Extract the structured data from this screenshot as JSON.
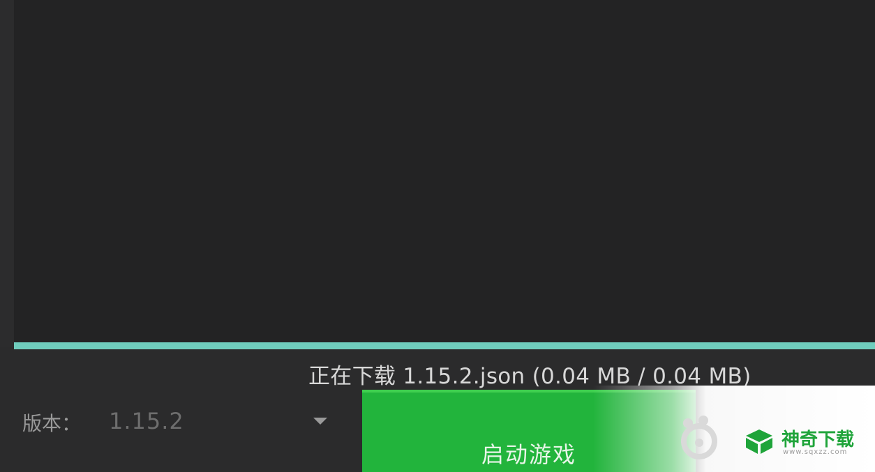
{
  "download": {
    "status_text": "正在下载 1.15.2.json (0.04 MB / 0.04 MB)",
    "progress_fraction": 1.0
  },
  "version": {
    "label": "版本：",
    "selected": "1.15.2"
  },
  "launch": {
    "label": "启动游戏"
  },
  "watermark": {
    "brand": "神奇下载",
    "url": "www.sqxzz.com"
  },
  "icons": {
    "dropdown": "triangle-down-icon",
    "watermark_logo": "baidu-logo-icon",
    "watermark_brand_logo": "box-logo-icon"
  },
  "colors": {
    "progress": "#6fcdbd",
    "launch_button": "#22b43c",
    "brand_green": "#1fa43a"
  }
}
